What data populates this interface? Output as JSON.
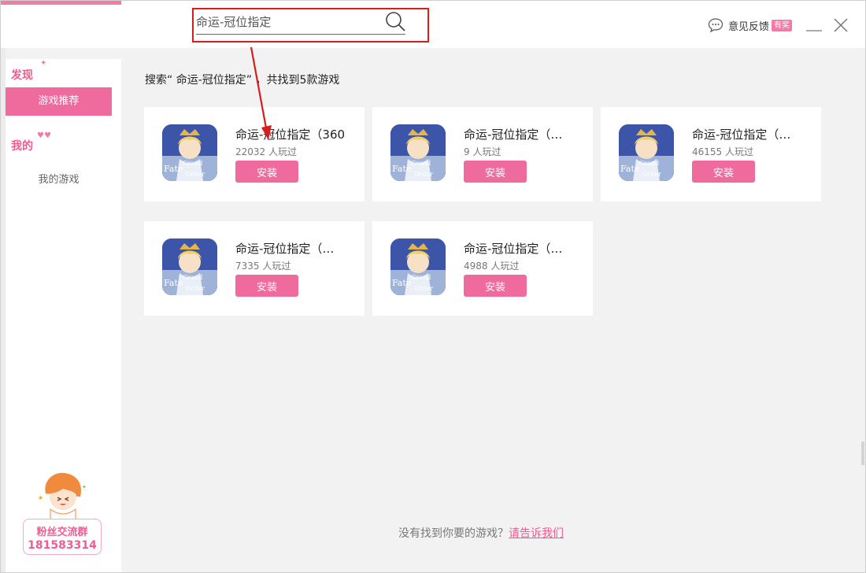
{
  "search": {
    "value": "命运-冠位指定",
    "placeholder": "命运-冠位指定"
  },
  "header": {
    "feedback_label": "意见反馈",
    "feedback_badge": "有奖",
    "icons": [
      "search-icon",
      "chat-icon",
      "minimize-icon",
      "close-icon"
    ]
  },
  "sidebar": {
    "discover_title": "发现",
    "items": [
      {
        "label": "游戏推荐",
        "active": true
      },
      {
        "label": "我的游戏",
        "active": false
      }
    ],
    "mine_title": "我的",
    "fan_group": {
      "label": "粉丝交流群",
      "number": "181583314"
    }
  },
  "main": {
    "result_heading": "搜索“ 命运-冠位指定” ，共找到5款游戏",
    "cards": [
      {
        "title": "命运-冠位指定（360",
        "players": "22032 人玩过",
        "install_label": "安装"
      },
      {
        "title": "命运-冠位指定（…",
        "players": "9 人玩过",
        "install_label": "安装"
      },
      {
        "title": "命运-冠位指定（…",
        "players": "46155 人玩过",
        "install_label": "安装"
      },
      {
        "title": "命运-冠位指定（…",
        "players": "7335 人玩过",
        "install_label": "安装"
      },
      {
        "title": "命运-冠位指定（…",
        "players": "4988 人玩过",
        "install_label": "安装"
      }
    ],
    "icon_text": {
      "fate": "Fate",
      "grand": "Grand",
      "order": "Order"
    }
  },
  "footer": {
    "prompt": "没有找到你要的游戏？",
    "link": "请告诉我们"
  },
  "colors": {
    "accent": "#f06b9d",
    "annotation": "#d81d1d"
  }
}
